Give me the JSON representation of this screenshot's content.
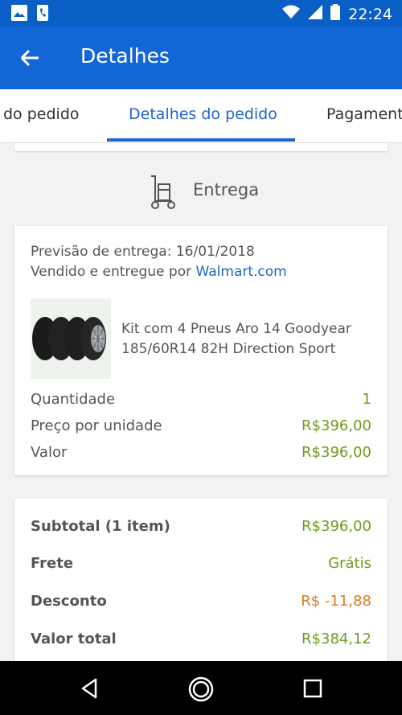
{
  "status_bar": {
    "time": "22:24",
    "icons": [
      "image-icon",
      "phone-icon",
      "wifi-icon",
      "signal-icon",
      "battery-icon"
    ]
  },
  "appbar": {
    "title": "Detalhes",
    "back_icon": "arrow-back-icon"
  },
  "tabs": [
    {
      "label": "do pedido"
    },
    {
      "label": "Detalhes do pedido"
    },
    {
      "label": "Pagament"
    }
  ],
  "active_tab": 1,
  "delivery": {
    "title": "Entrega",
    "icon": "hand-truck-icon"
  },
  "order": {
    "eta": "Previsão de entrega: 16/01/2018",
    "seller_prefix": "Vendido e entregue por ",
    "seller_link": "Walmart.com",
    "product_name": "Kit com 4 Pneus Aro 14 Goodyear 185/60R14 82H Direction Sport",
    "rows": [
      {
        "label": "Quantidade",
        "value": "1"
      },
      {
        "label": "Preço por unidade",
        "value": "R$396,00"
      },
      {
        "label": "Valor",
        "value": "R$396,00"
      }
    ]
  },
  "summary": {
    "rows": [
      {
        "label": "Subtotal (1 item)",
        "value": "R$396,00"
      },
      {
        "label": "Frete",
        "value": "Grátis"
      },
      {
        "label": "Desconto",
        "value": "R$ -11,88"
      },
      {
        "label": "Valor total",
        "value": "R$384,12"
      }
    ]
  },
  "colors": {
    "primary": "#1366d6",
    "status": "#0a5fc6",
    "link": "#1f65c8",
    "green": "#6e9c1c",
    "orange": "#e07a20"
  }
}
